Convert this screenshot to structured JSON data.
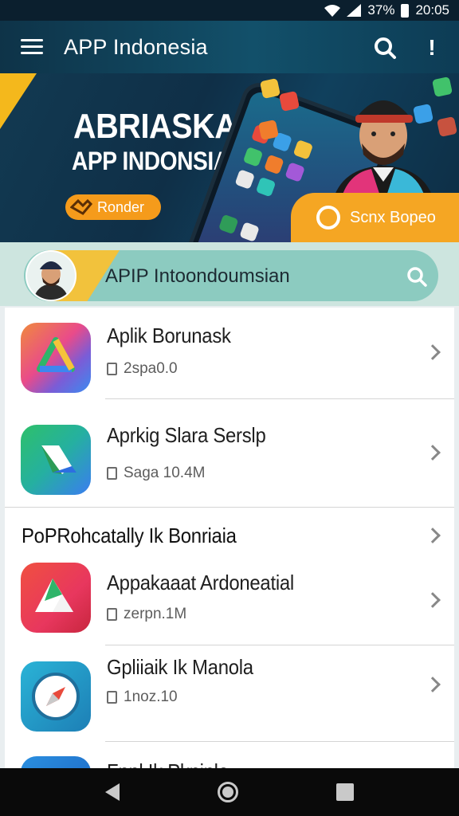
{
  "status_bar": {
    "battery": "37%",
    "time": "20:05"
  },
  "app_bar": {
    "title": "APP Indonesia"
  },
  "hero": {
    "title_line1": "ABRIASKAA",
    "title_line2": "APP INDONSIA",
    "pill_button_label": "Ronder",
    "cta_label": "Scnx Bopeo"
  },
  "search_bar": {
    "text": "APIP Intoondoumsian"
  },
  "apps": [
    {
      "title": "Aplik Borunask",
      "meta": "2spa0.0",
      "icon": "drive-triangle-icon"
    },
    {
      "title": "Aprkig Slara Serslp",
      "meta": "Saga 10.4M",
      "icon": "drive-arrow-icon"
    }
  ],
  "section": {
    "title": "PoPRohcatally Ik Bonriaia"
  },
  "apps2": [
    {
      "title": "Appakaaat Ardoneatial",
      "meta": "zerpn.1M",
      "icon": "red-triangle-icon"
    },
    {
      "title": "Gpliiaik Ik Manola",
      "meta": "1noz.10",
      "icon": "compass-icon"
    },
    {
      "title": "Fnnl Ik Pkninle",
      "meta": "",
      "icon": "blue-app-icon"
    }
  ],
  "colors": {
    "appbar": "#0e3348",
    "accent_yellow": "#f4b81c",
    "accent_orange": "#f59b1b",
    "search_pill": "#8ccbc0"
  }
}
